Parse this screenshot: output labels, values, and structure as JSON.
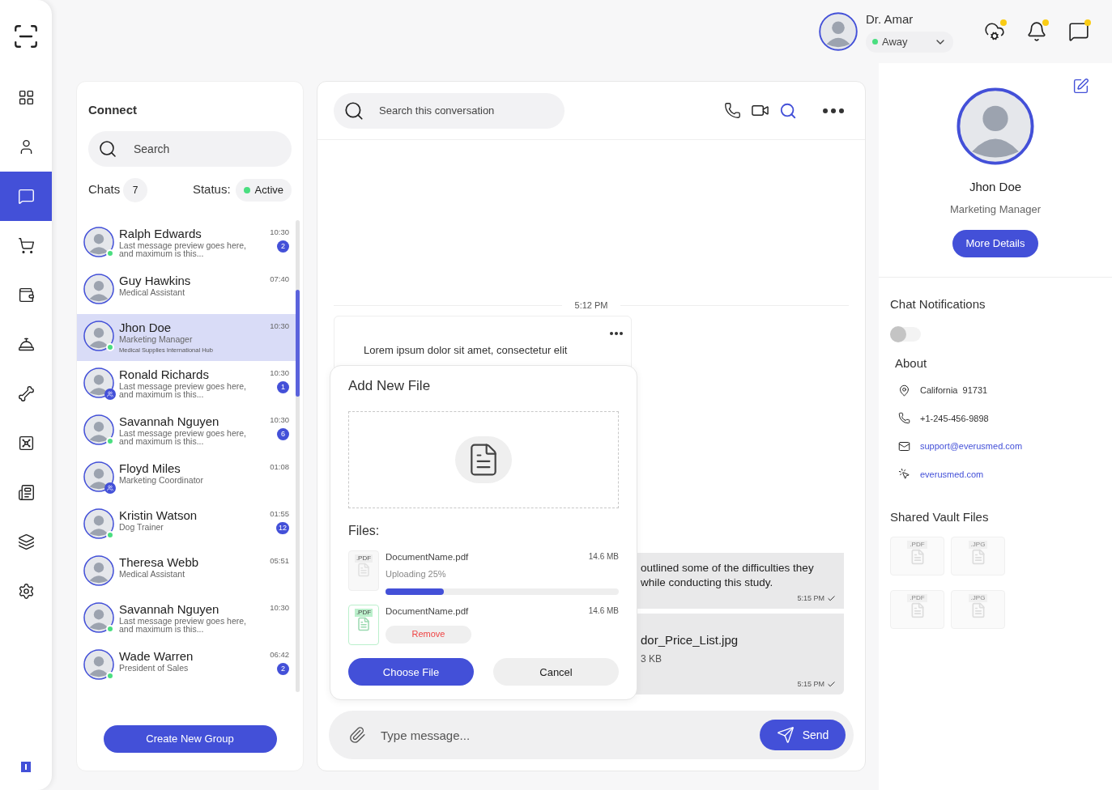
{
  "sidebar": {
    "items": [
      {
        "selected": false
      },
      {
        "selected": false
      },
      {
        "selected": true
      },
      {
        "selected": false
      },
      {
        "selected": false
      },
      {
        "selected": false
      },
      {
        "selected": false
      },
      {
        "selected": false
      },
      {
        "selected": false
      },
      {
        "selected": false
      },
      {
        "selected": false
      }
    ]
  },
  "topbar": {
    "user": {
      "name": "Dr. Amar",
      "status": "Away"
    },
    "notifications": [
      {
        "dot": true
      },
      {
        "dot": true
      },
      {
        "dot": true
      }
    ]
  },
  "connect": {
    "title": "Connect",
    "search": {
      "placeholder": "Search"
    },
    "chats_label": "Chats",
    "chats_count": "7",
    "status_label": "Status:",
    "status": "Active",
    "contacts": [
      {
        "kind": "online",
        "name": "Ralph Edwards",
        "subtitle": "Last message preview goes here, and maximum is this...",
        "time": "10:30",
        "unread": "2",
        "selected": false
      },
      {
        "kind": "plain",
        "name": "Guy Hawkins",
        "subtitle": "Medical Assistant",
        "time": "07:40",
        "selected": false
      },
      {
        "kind": "online",
        "name": "Jhon Doe",
        "subtitle": "Marketing Manager",
        "detail": "Medical Supplies International Hub",
        "time": "10:30",
        "selected": true
      },
      {
        "kind": "group",
        "name": "Ronald Richards",
        "subtitle": "Last message preview goes here, and maximum is this...",
        "time": "10:30",
        "unread": "1",
        "selected": false
      },
      {
        "kind": "online",
        "name": "Savannah Nguyen",
        "subtitle": "Last message preview goes here, and maximum is this...",
        "time": "10:30",
        "unread": "6",
        "selected": false
      },
      {
        "kind": "group",
        "name": "Floyd Miles",
        "subtitle": "Marketing Coordinator",
        "time": "01:08",
        "selected": false
      },
      {
        "kind": "online",
        "name": "Kristin Watson",
        "subtitle": "Dog Trainer",
        "time": "01:55",
        "unread": "12",
        "selected": false
      },
      {
        "kind": "plain",
        "name": "Theresa Webb",
        "subtitle": "Medical Assistant",
        "time": "05:51",
        "selected": false
      },
      {
        "kind": "online",
        "name": "Savannah Nguyen",
        "subtitle": "Last message preview goes here, and maximum is this...",
        "time": "10:30",
        "selected": false
      },
      {
        "kind": "online",
        "name": "Wade Warren",
        "subtitle": "President of Sales",
        "time": "06:42",
        "unread": "2",
        "selected": false
      }
    ],
    "create_button": "Create New Group"
  },
  "conversation": {
    "search": {
      "placeholder": "Search this conversation"
    },
    "date": "5:12 PM",
    "incoming": {
      "text": "Lorem ipsum dolor sit amet, consectetur elit"
    },
    "outgoing": [
      {
        "kind": "text",
        "lines": [
          "outlined some of the difficulties they",
          "while conducting this study."
        ],
        "time": "5:15 PM"
      },
      {
        "kind": "file",
        "name": "dor_Price_List.jpg",
        "size": "3 KB",
        "time": "5:15 PM"
      }
    ],
    "composer": {
      "placeholder": "Type message...",
      "send": "Send"
    }
  },
  "dialog": {
    "title": "Add New File",
    "files_label": "Files:",
    "files": [
      {
        "kind": "uploading",
        "name": "DocumentName.pdf",
        "size": "14.6 MB",
        "type": ".PDF",
        "status": "Uploading 25%",
        "level": 0.25
      },
      {
        "kind": "done",
        "name": "DocumentName.pdf",
        "size": "14.6 MB",
        "type": ".PDF",
        "action": "Remove"
      }
    ],
    "choose": "Choose File",
    "cancel": "Cancel"
  },
  "profile": {
    "name": "Jhon Doe",
    "role": "Marketing Manager",
    "button": "More Details",
    "notifications_label": "Chat Notifications",
    "notifications_on": false,
    "about_title": "About",
    "about": [
      {
        "kind": "location",
        "text": "California  91731"
      },
      {
        "kind": "phone",
        "text": "+1-245-456-9898"
      },
      {
        "kind": "email",
        "text": "support@everusmed.com"
      },
      {
        "kind": "web",
        "text": "everusmed.com"
      }
    ],
    "vault_title": "Shared Vault Files",
    "vault_files": [
      {
        "type": ".PDF"
      },
      {
        "type": ".JPG"
      },
      {
        "type": ".PDF"
      },
      {
        "type": ".JPG"
      }
    ]
  }
}
